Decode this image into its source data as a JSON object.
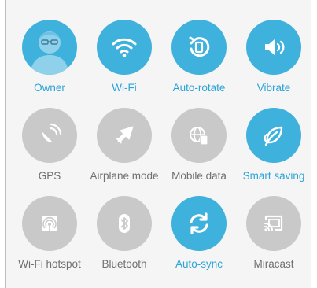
{
  "colors": {
    "active": "#3fb1dd",
    "active_text": "#2da4d6",
    "inactive": "#c9c9c9",
    "inactive_text": "#6f6f6f"
  },
  "tiles": [
    {
      "label": "Owner",
      "icon": "user-avatar-icon",
      "state": "on"
    },
    {
      "label": "Wi-Fi",
      "icon": "wifi-icon",
      "state": "on"
    },
    {
      "label": "Auto-rotate",
      "icon": "auto-rotate-icon",
      "state": "on"
    },
    {
      "label": "Vibrate",
      "icon": "vibrate-speaker-icon",
      "state": "on"
    },
    {
      "label": "GPS",
      "icon": "gps-satellite-icon",
      "state": "off"
    },
    {
      "label": "Airplane mode",
      "icon": "airplane-icon",
      "state": "off"
    },
    {
      "label": "Mobile data",
      "icon": "mobile-data-globe-icon",
      "state": "off"
    },
    {
      "label": "Smart saving",
      "icon": "leaf-icon",
      "state": "on"
    },
    {
      "label": "Wi-Fi hotspot",
      "icon": "hotspot-icon",
      "state": "off"
    },
    {
      "label": "Bluetooth",
      "icon": "bluetooth-icon",
      "state": "off"
    },
    {
      "label": "Auto-sync",
      "icon": "sync-icon",
      "state": "on"
    },
    {
      "label": "Miracast",
      "icon": "cast-icon",
      "state": "off"
    }
  ]
}
